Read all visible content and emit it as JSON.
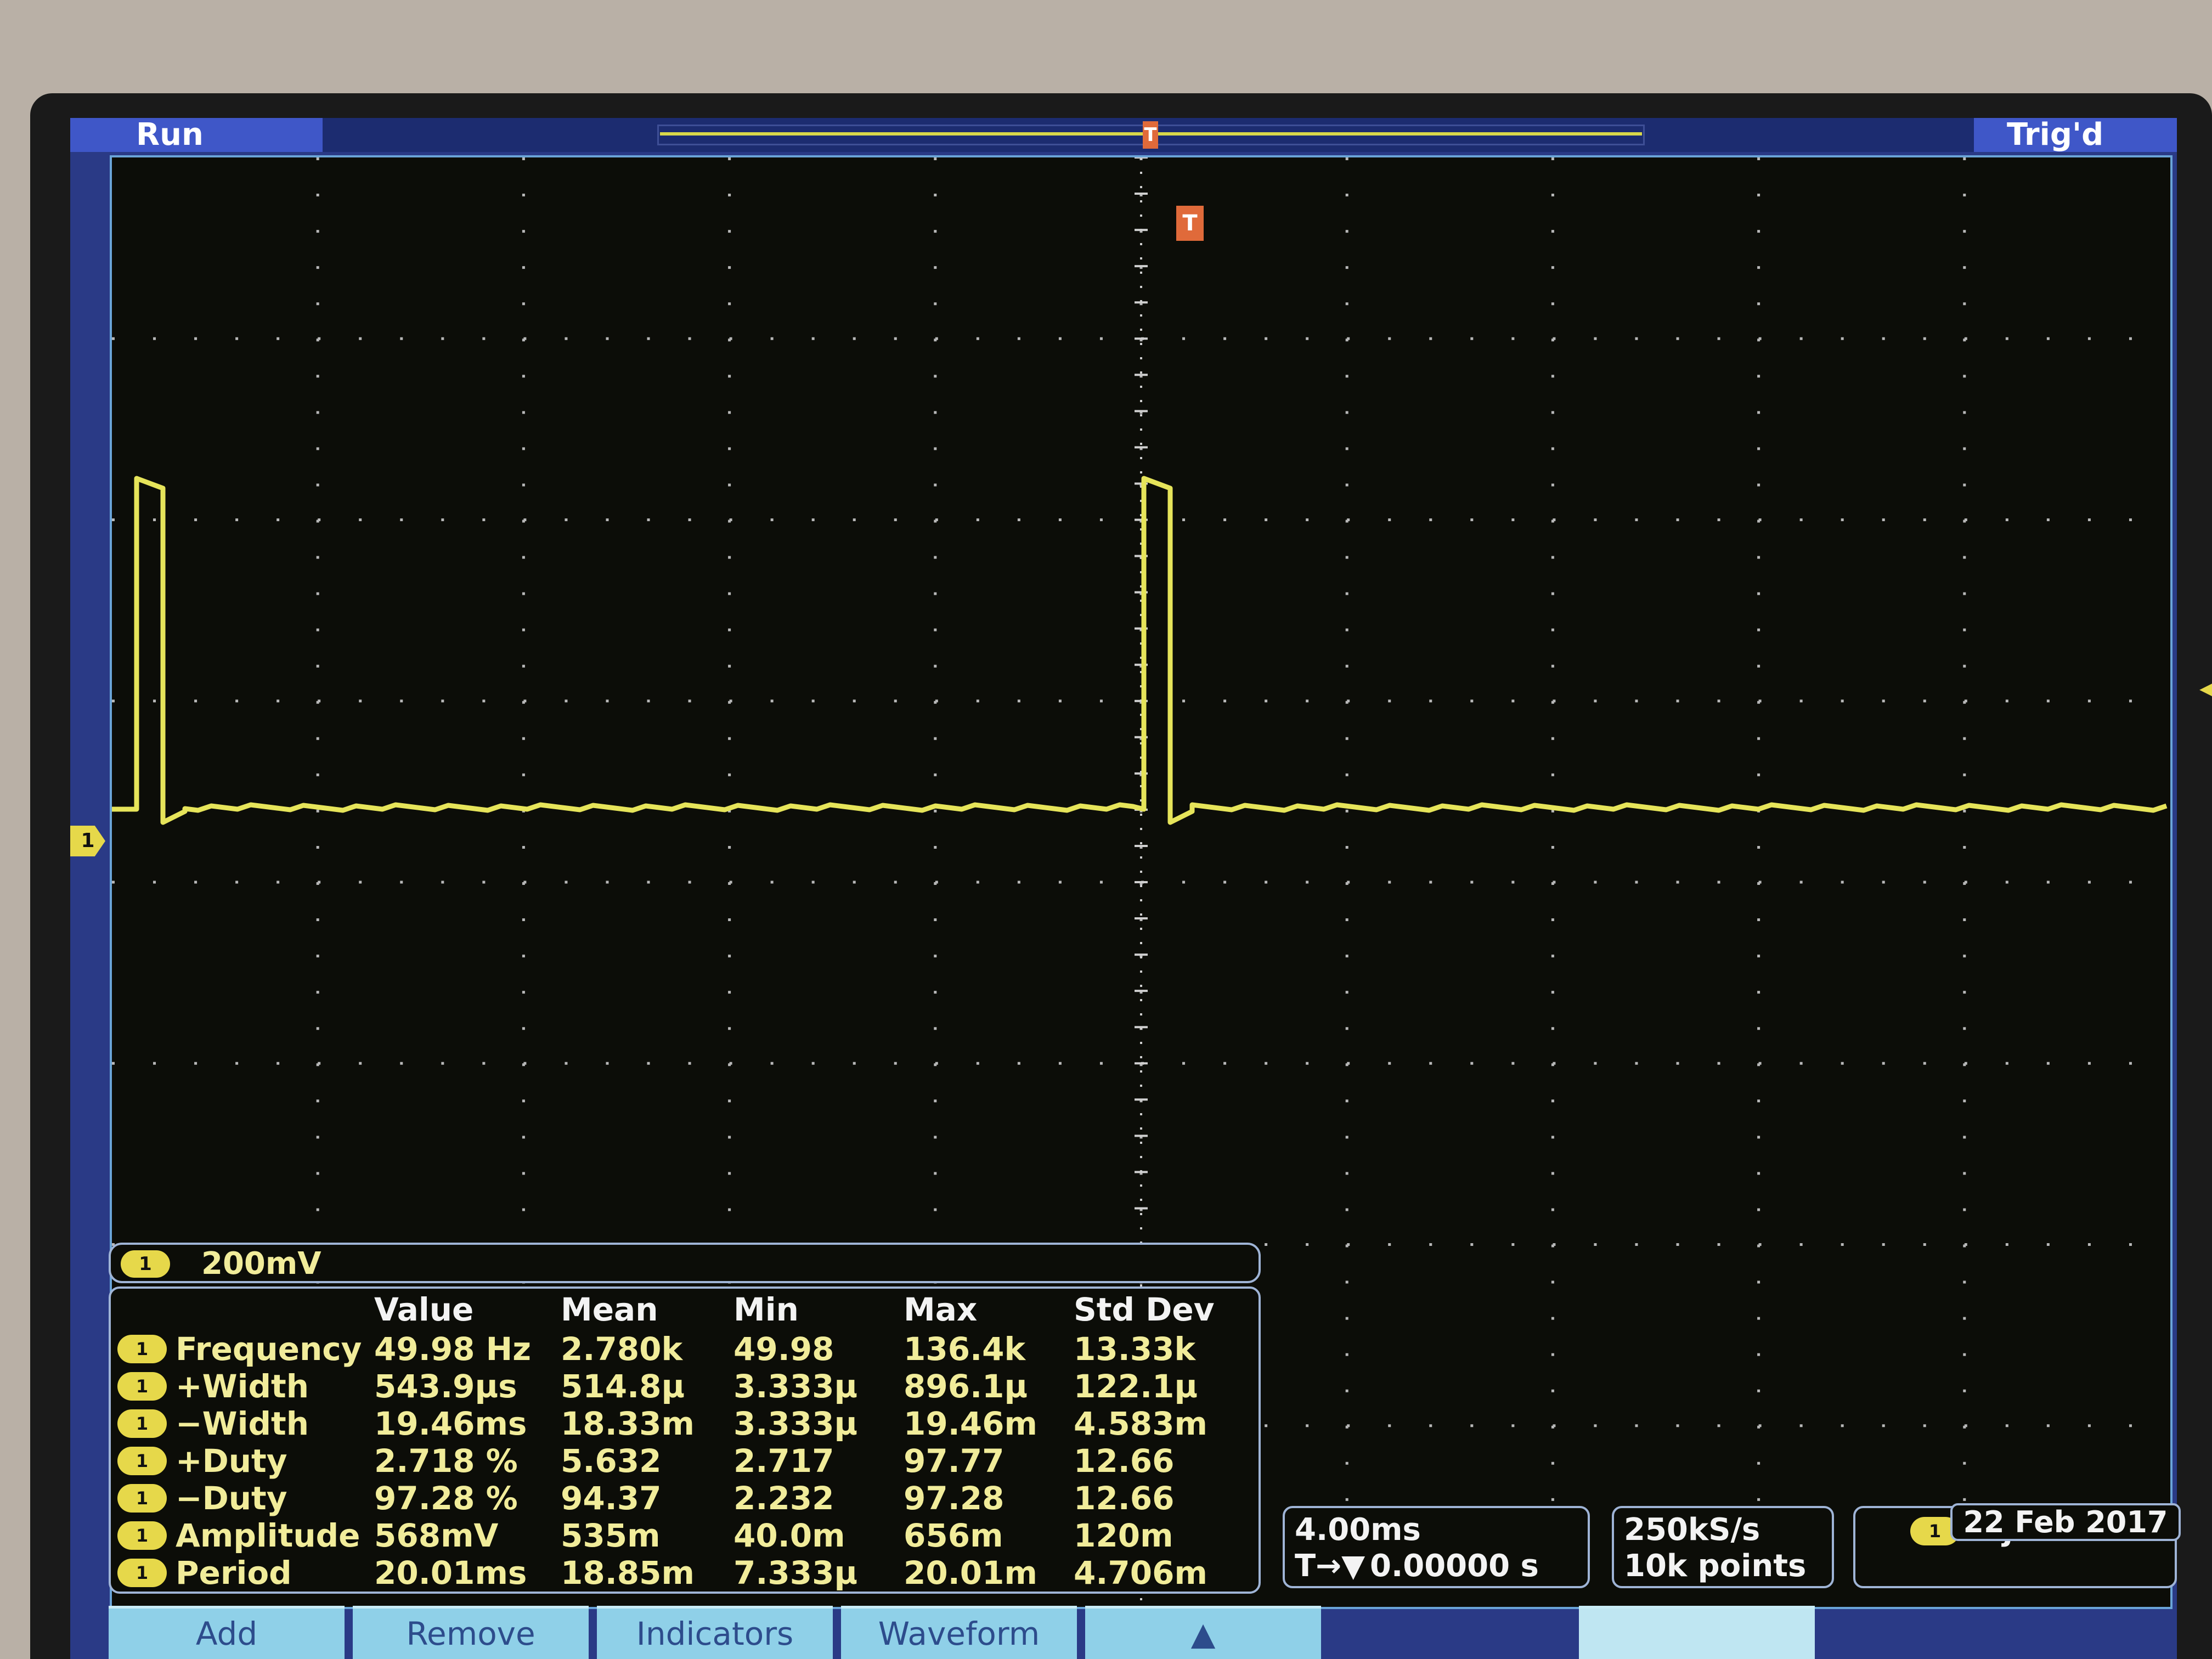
{
  "status": {
    "run": "Run",
    "trigger": "Trig'd"
  },
  "channel": {
    "badge": "1",
    "scale": "200mV"
  },
  "measurements": {
    "headers": [
      "Value",
      "Mean",
      "Min",
      "Max",
      "Std Dev"
    ],
    "rows": [
      {
        "name": "Frequency",
        "value": "49.98 Hz",
        "mean": "2.780k",
        "min": "49.98",
        "max": "136.4k",
        "std": "13.33k"
      },
      {
        "name": "+Width",
        "value": "543.9µs",
        "mean": "514.8µ",
        "min": "3.333µ",
        "max": "896.1µ",
        "std": "122.1µ"
      },
      {
        "name": "−Width",
        "value": "19.46ms",
        "mean": "18.33m",
        "min": "3.333µ",
        "max": "19.46m",
        "std": "4.583m"
      },
      {
        "name": "+Duty",
        "value": "2.718 %",
        "mean": "5.632",
        "min": "2.717",
        "max": "97.77",
        "std": "12.66"
      },
      {
        "name": "−Duty",
        "value": "97.28 %",
        "mean": "94.37",
        "min": "2.232",
        "max": "97.28",
        "std": "12.66"
      },
      {
        "name": "Amplitude",
        "value": "568mV",
        "mean": "535m",
        "min": "40.0m",
        "max": "656m",
        "std": "120m"
      },
      {
        "name": "Period",
        "value": "20.01ms",
        "mean": "18.85m",
        "min": "7.333µ",
        "max": "20.01m",
        "std": "4.706m"
      }
    ]
  },
  "timebase": {
    "scale": "4.00ms",
    "delay": "0.00000 s"
  },
  "acquisition": {
    "rate": "250kS/s",
    "points": "10k points"
  },
  "trigger": {
    "badge": "1",
    "slope": "rising-edge-icon",
    "level": "256mV"
  },
  "menu": {
    "add": "Add",
    "remove": "Remove",
    "indicators": "Indicators",
    "waveform": "Waveform"
  },
  "date": "22 Feb 2017",
  "colors": {
    "trace": "#e6e45a",
    "trigger": "#e06a3a",
    "screen_bg": "#0c0d08",
    "accent": "#3f57c8"
  }
}
